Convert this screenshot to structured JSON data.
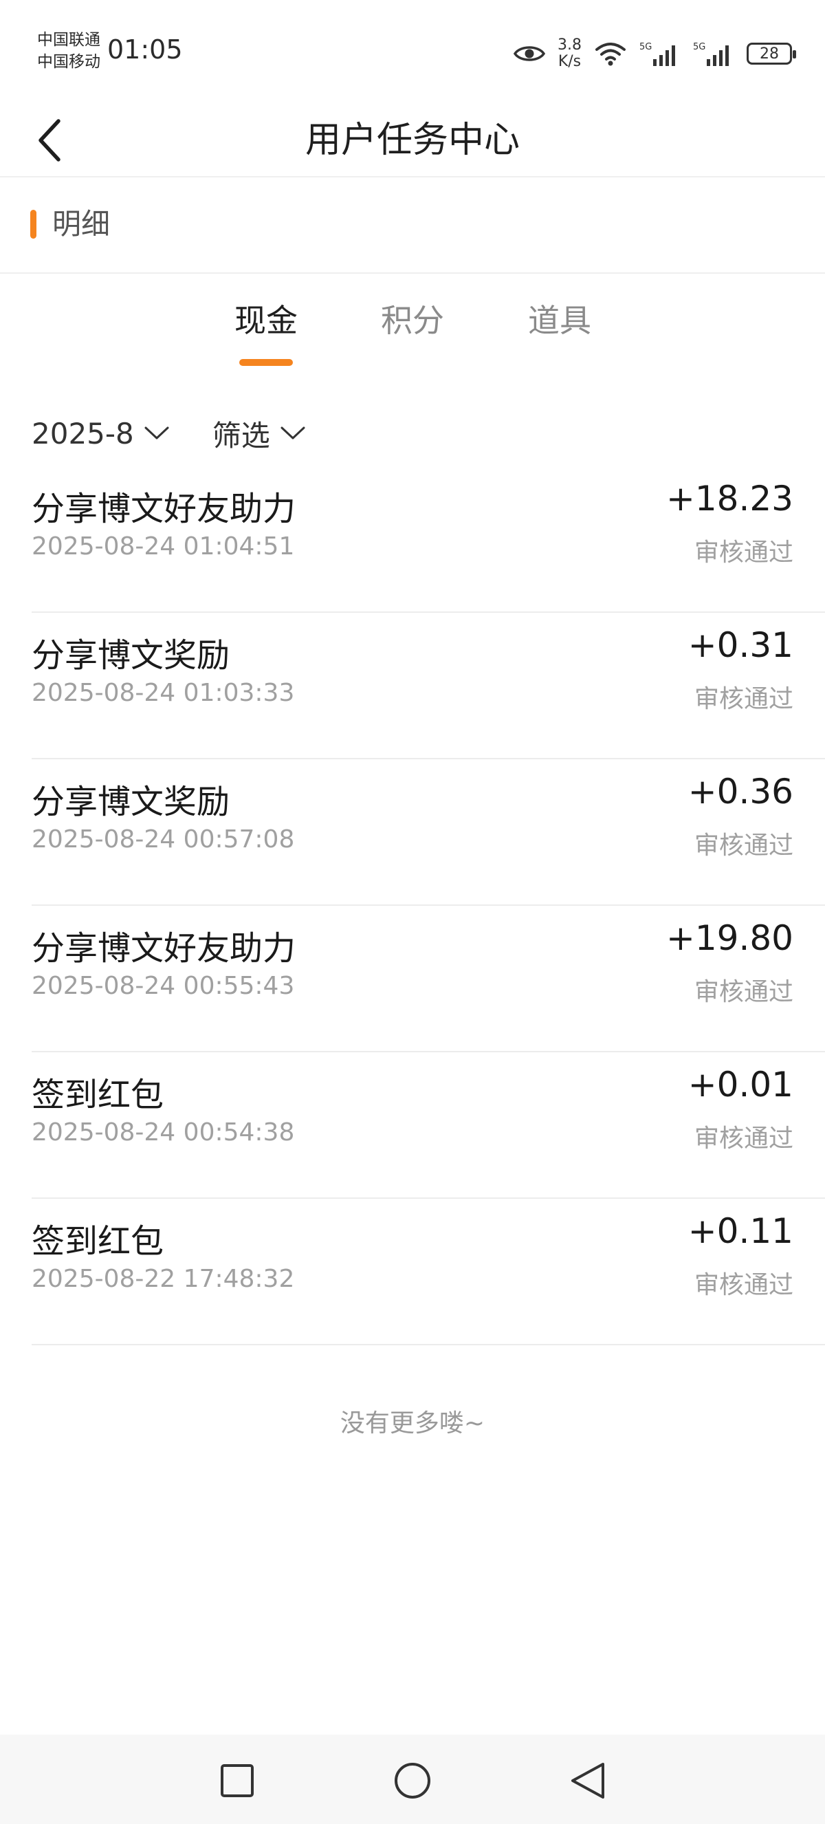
{
  "status_bar": {
    "carrier_1": "中国联通",
    "carrier_2": "中国移动",
    "time": "01:05",
    "net_speed_value": "3.8",
    "net_speed_unit": "K/s",
    "battery": "28",
    "signal_label": "5G"
  },
  "header": {
    "title": "用户任务中心",
    "back_icon": "chevron-left-icon"
  },
  "section": {
    "title": "明细",
    "accent_color": "#f5841f"
  },
  "tabs": [
    {
      "label": "现金",
      "active": true
    },
    {
      "label": "积分",
      "active": false
    },
    {
      "label": "道具",
      "active": false
    }
  ],
  "filters": {
    "month": "2025-8",
    "filter_label": "筛选"
  },
  "records": [
    {
      "title": "分享博文好友助力",
      "time": "2025-08-24 01:04:51",
      "amount": "+18.23",
      "status": "审核通过"
    },
    {
      "title": "分享博文奖励",
      "time": "2025-08-24 01:03:33",
      "amount": "+0.31",
      "status": "审核通过"
    },
    {
      "title": "分享博文奖励",
      "time": "2025-08-24 00:57:08",
      "amount": "+0.36",
      "status": "审核通过"
    },
    {
      "title": "分享博文好友助力",
      "time": "2025-08-24 00:55:43",
      "amount": "+19.80",
      "status": "审核通过"
    },
    {
      "title": "签到红包",
      "time": "2025-08-24 00:54:38",
      "amount": "+0.01",
      "status": "审核通过"
    },
    {
      "title": "签到红包",
      "time": "2025-08-22 17:48:32",
      "amount": "+0.11",
      "status": "审核通过"
    }
  ],
  "end_note": "没有更多喽~",
  "nav_bar": {
    "recents_icon": "square-icon",
    "home_icon": "circle-icon",
    "back_icon": "triangle-back-icon"
  }
}
